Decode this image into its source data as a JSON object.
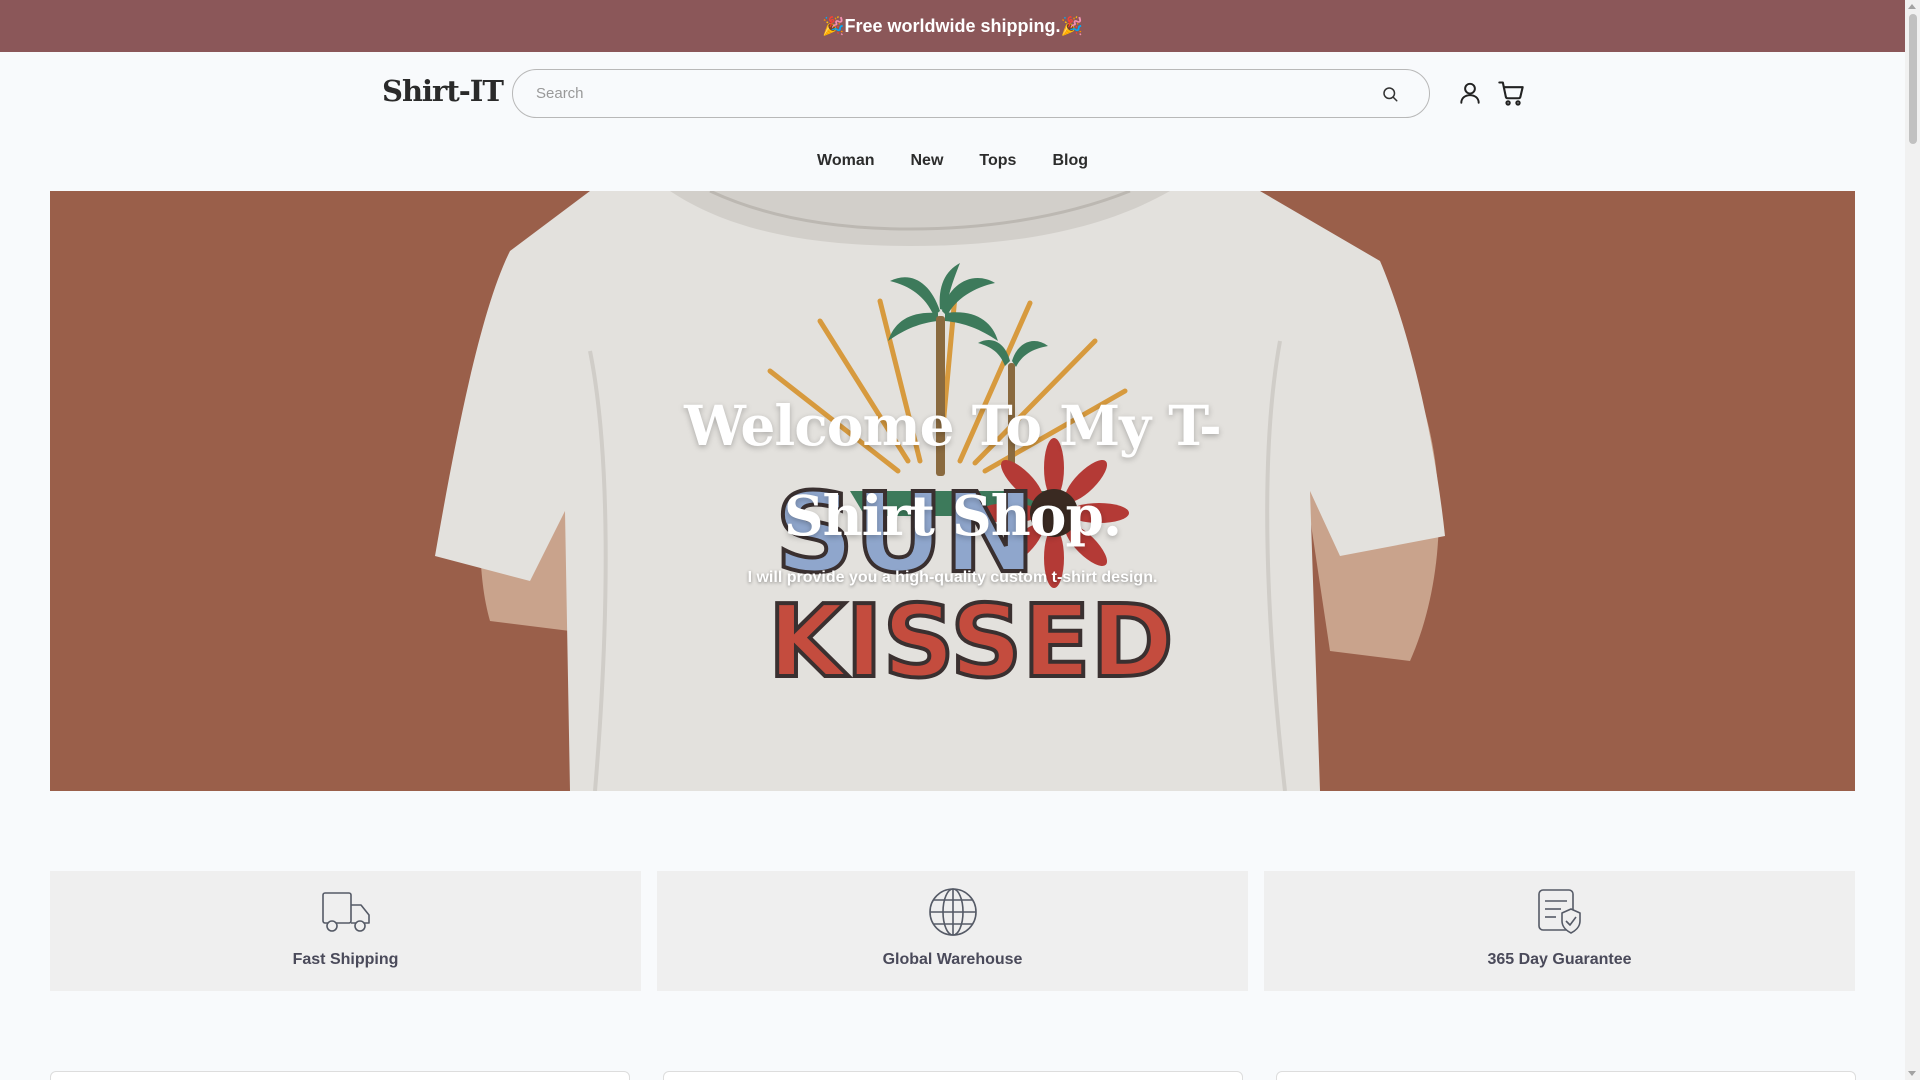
{
  "announcement": {
    "text": "Free worldwide shipping.",
    "emoji": "🎉"
  },
  "header": {
    "logo": "Shirt-IT",
    "search_placeholder": "Search",
    "icons": {
      "search": "search-icon",
      "account": "user-icon",
      "cart": "cart-icon"
    }
  },
  "nav": {
    "items": [
      "Woman",
      "New",
      "Tops",
      "Blog"
    ]
  },
  "hero": {
    "title": "Welcome To My T-Shirt Shop.",
    "subtitle": "I will provide you a high-quality custom t-shirt design.",
    "shirt_print": {
      "line1": "SUN",
      "line2": "KISSED"
    }
  },
  "features": [
    {
      "label": "Fast Shipping",
      "icon": "truck-icon"
    },
    {
      "label": "Global Warehouse",
      "icon": "globe-icon"
    },
    {
      "label": "365 Day Guarantee",
      "icon": "guarantee-icon"
    }
  ],
  "colors": {
    "announcement_bg": "#8b5759",
    "hero_bg": "#9a5f4a",
    "feature_bg": "#efefef",
    "page_bg": "#f8fafc"
  }
}
